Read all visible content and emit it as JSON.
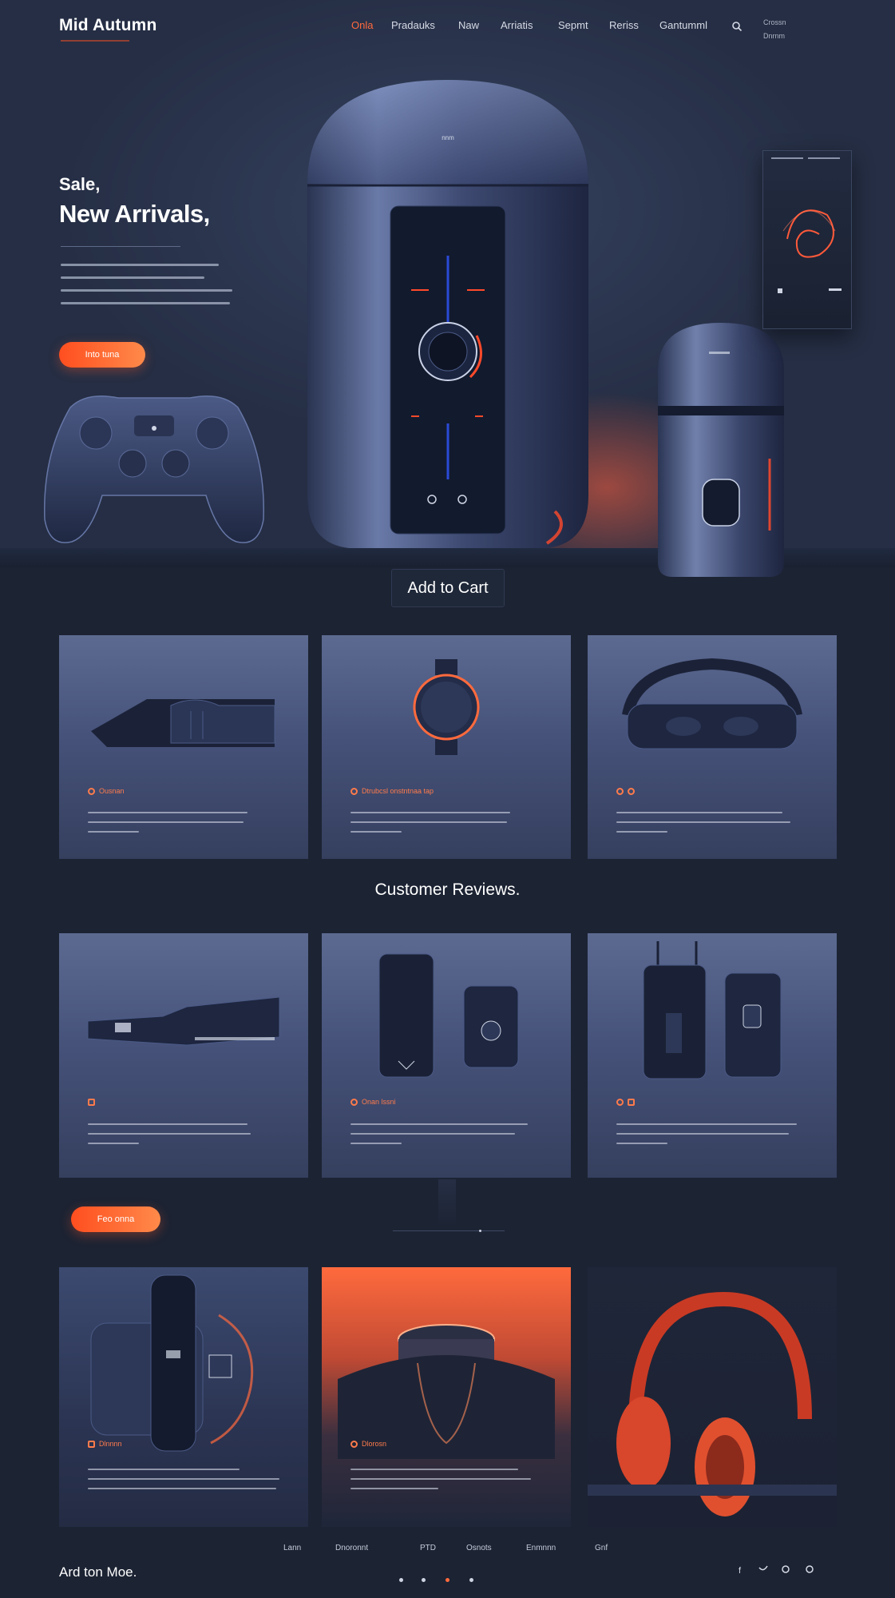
{
  "brand": {
    "name": "Mid Autumn"
  },
  "nav": {
    "items": [
      "Onla",
      "Pradauks",
      "Naw",
      "Arriatis",
      "Sepmt",
      "Reriss",
      "Gantumml"
    ],
    "active_index": 0,
    "mini_top": "Crossn",
    "mini_bottom": "Dnrnm"
  },
  "hero": {
    "eyebrow": "Sale,",
    "title": "New Arrivals,",
    "cta_label": "Into tuna",
    "speaker_brand": "nnm",
    "add_to_cart_label": "Add to Cart"
  },
  "cards_row1": [
    {
      "tag": "Ousnan"
    },
    {
      "tag": "Dtrubcsl onstntnaa tap"
    },
    {
      "tag": ""
    }
  ],
  "reviews": {
    "heading": "Customer Reviews."
  },
  "cards_row2": [
    {
      "tag": ""
    },
    {
      "tag": "Onan lssni"
    },
    {
      "tag": ""
    }
  ],
  "promo": {
    "label": "Feo onna"
  },
  "cards_row3": [
    {
      "tag": "Dlnnnn"
    },
    {
      "tag": "Dlorosn"
    }
  ],
  "footer": {
    "brand": "Ard ton Moe.",
    "links": [
      "Lann",
      "Dnoronnt",
      "PTD",
      "Osnots",
      "Enmnnn",
      "Gnf"
    ]
  },
  "colors": {
    "accent": "#ff6a3d",
    "background": "#1c2333",
    "card": "#4a5679"
  }
}
